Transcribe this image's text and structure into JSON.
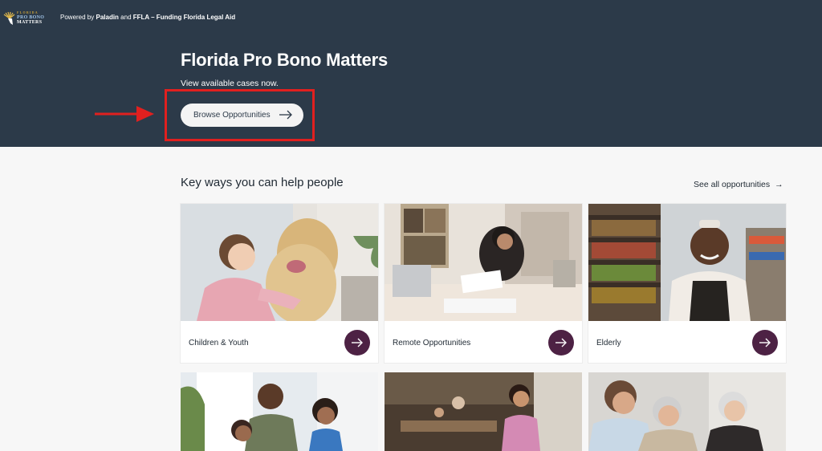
{
  "header": {
    "logo_lines": [
      "FLORIDA",
      "PRO BONO",
      "MATTERS"
    ],
    "powered_prefix": "Powered by",
    "powered_by_1": "Paladin",
    "powered_and": "and",
    "powered_by_2": "FFLA – Funding Florida Legal Aid"
  },
  "hero": {
    "title": "Florida Pro Bono Matters",
    "subtitle": "View available cases now.",
    "cta_label": "Browse Opportunities"
  },
  "section": {
    "title": "Key ways you can help people",
    "see_all_label": "See all opportunities"
  },
  "cards": [
    {
      "label": "Children & Youth"
    },
    {
      "label": "Remote Opportunities"
    },
    {
      "label": "Elderly"
    }
  ],
  "colors": {
    "hero_bg": "#2c3a49",
    "accent_button": "#4d2244",
    "annotation_red": "#e1201f",
    "page_bg": "#f7f7f7"
  }
}
